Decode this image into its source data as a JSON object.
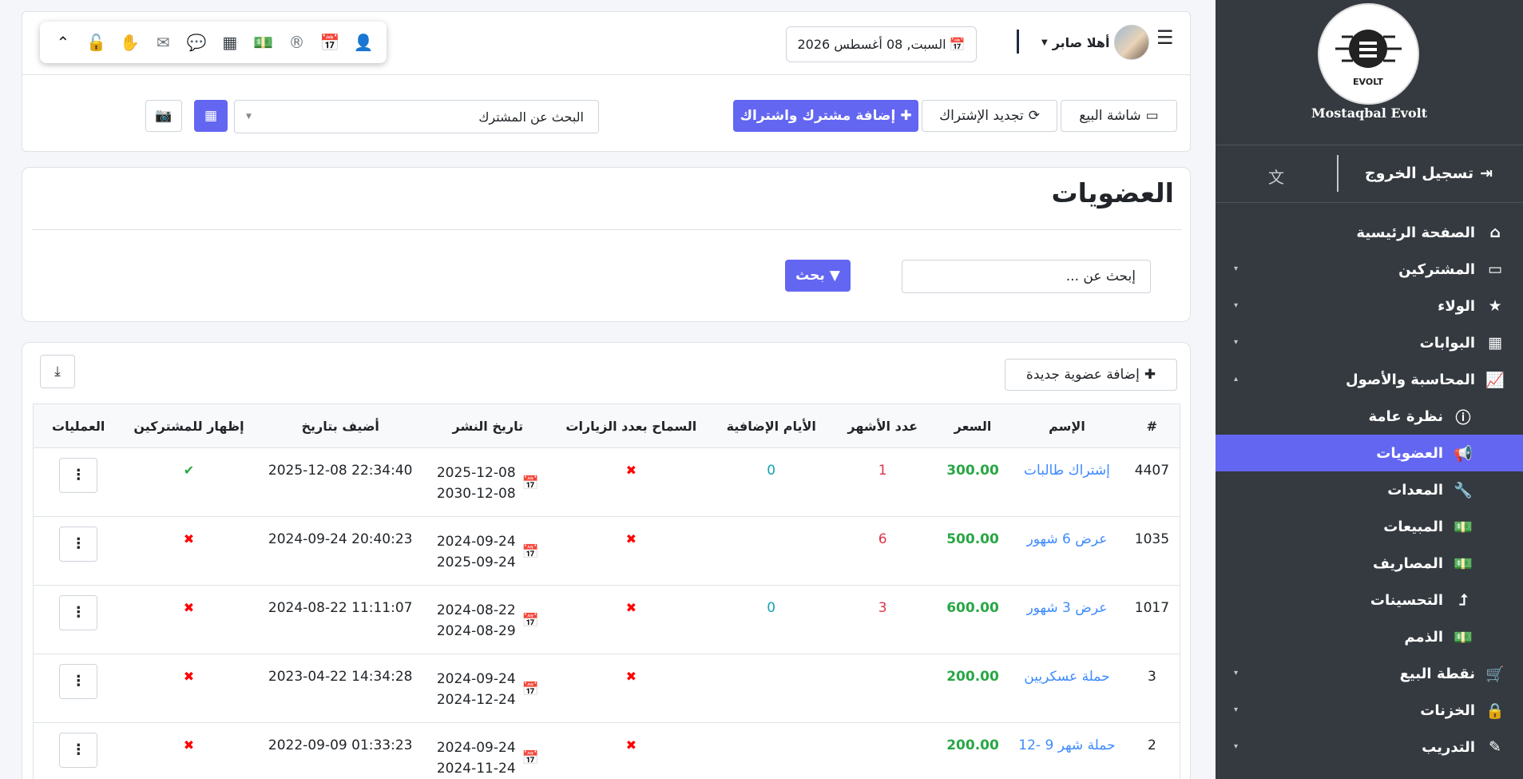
{
  "sidebar": {
    "brand_name": "Mostaqbal Evolt",
    "logout_label": "تسجيل الخروج",
    "items": [
      {
        "label": "الصفحة الرئيسية",
        "icon": "home-icon",
        "glyph": "⌂",
        "caret": "",
        "sub": false,
        "active": false
      },
      {
        "label": "المشتركين",
        "icon": "laptop-icon",
        "glyph": "▭",
        "caret": "▾",
        "sub": false,
        "active": false
      },
      {
        "label": "الولاء",
        "icon": "star-icon",
        "glyph": "★",
        "caret": "▾",
        "sub": false,
        "active": false
      },
      {
        "label": "البوابات",
        "icon": "building-icon",
        "glyph": "▦",
        "caret": "▾",
        "sub": false,
        "active": false
      },
      {
        "label": "المحاسبة والأصول",
        "icon": "chart-line-icon",
        "glyph": "📈",
        "caret": "▴",
        "sub": false,
        "active": false
      },
      {
        "label": "نظرة عامة",
        "icon": "info-icon",
        "glyph": "ⓘ",
        "caret": "",
        "sub": true,
        "active": false
      },
      {
        "label": "العضويات",
        "icon": "megaphone-icon",
        "glyph": "📢",
        "caret": "",
        "sub": true,
        "active": true
      },
      {
        "label": "المعدات",
        "icon": "wrench-icon",
        "glyph": "🔧",
        "caret": "",
        "sub": true,
        "active": false
      },
      {
        "label": "المبيعات",
        "icon": "money-icon",
        "glyph": "💵",
        "caret": "",
        "sub": true,
        "active": false
      },
      {
        "label": "المصاريف",
        "icon": "money-icon",
        "glyph": "💵",
        "caret": "",
        "sub": true,
        "active": false
      },
      {
        "label": "التحسينات",
        "icon": "arrow-up-icon",
        "glyph": "⮥",
        "caret": "",
        "sub": true,
        "active": false
      },
      {
        "label": "الذمم",
        "icon": "money-icon",
        "glyph": "💵",
        "caret": "",
        "sub": true,
        "active": false
      },
      {
        "label": "نقطة البيع",
        "icon": "cart-icon",
        "glyph": "🛒",
        "caret": "▾",
        "sub": false,
        "active": false
      },
      {
        "label": "الخزنات",
        "icon": "lock-icon",
        "glyph": "🔒",
        "caret": "▾",
        "sub": false,
        "active": false
      },
      {
        "label": "التدريب",
        "icon": "magic-wand-icon",
        "glyph": "✎",
        "caret": "▾",
        "sub": false,
        "active": false
      }
    ]
  },
  "topbar": {
    "date": "السبت, 08 أغسطس 2026",
    "greeting": "أهلا صابر",
    "pill_icons": [
      {
        "name": "chevron-up-icon",
        "glyph": "⌃",
        "color": "#212529"
      },
      {
        "name": "unlock-icon",
        "glyph": "🔓",
        "color": "#212529"
      },
      {
        "name": "hand-icon",
        "glyph": "✋",
        "color": "#17a2b8"
      },
      {
        "name": "envelope-icon",
        "glyph": "✉",
        "color": "#6c757d"
      },
      {
        "name": "comment-icon",
        "glyph": "💬",
        "color": "#6c757d"
      },
      {
        "name": "qrcode-icon",
        "glyph": "▦",
        "color": "#343a40"
      },
      {
        "name": "money-bill-icon",
        "glyph": "💵",
        "color": "#e83e8c"
      },
      {
        "name": "registered-icon",
        "glyph": "®",
        "color": "#6c757d"
      },
      {
        "name": "calendar-icon",
        "glyph": "📅",
        "color": "#007bff"
      },
      {
        "name": "user-plus-icon",
        "glyph": "👤",
        "color": "#28a745"
      }
    ],
    "pos_label": "شاشة البيع",
    "renew_label": "تجديد الإشتراك",
    "add_subscriber_label": "إضافة مشترك واشتراك",
    "subscriber_search_placeholder": "البحث عن المشترك"
  },
  "filter": {
    "title": "العضويات",
    "search_placeholder": "إبحث عن ...",
    "search_button": "بحث"
  },
  "table": {
    "add_membership_label": "إضافة عضوية جديدة",
    "headers": {
      "id": "#",
      "name": "الإسم",
      "price": "السعر",
      "months": "عدد الأشهر",
      "extra_days": "الأيام الإضافية",
      "visits": "السماح بعدد الزيارات",
      "publish_date": "تاريخ النشر",
      "added_at": "أضيف بتاريخ",
      "show": "إظهار للمشتركين",
      "ops": "العمليات"
    },
    "rows": [
      {
        "id": "4407",
        "name": "إشتراك طالبات",
        "price": "300.00",
        "months": "1",
        "extra_days": "0",
        "visits": "✖",
        "pub_start": "2025-12-08",
        "pub_end": "2030-12-08",
        "added_at": "2025-12-08 22:34:40",
        "show": "✔",
        "show_ok": true,
        "ops": "⋮"
      },
      {
        "id": "1035",
        "name": "عرض 6 شهور",
        "price": "500.00",
        "months": "6",
        "extra_days": "",
        "visits": "✖",
        "pub_start": "2024-09-24",
        "pub_end": "2025-09-24",
        "added_at": "2024-09-24 20:40:23",
        "show": "✖",
        "show_ok": false,
        "ops": "⋮"
      },
      {
        "id": "1017",
        "name": "عرض 3 شهور",
        "price": "600.00",
        "months": "3",
        "extra_days": "0",
        "visits": "✖",
        "pub_start": "2024-08-22",
        "pub_end": "2024-08-29",
        "added_at": "2024-08-22 11:11:07",
        "show": "✖",
        "show_ok": false,
        "ops": "⋮"
      },
      {
        "id": "3",
        "name": "حملة عسكريين",
        "price": "200.00",
        "months": "",
        "extra_days": "",
        "visits": "✖",
        "pub_start": "2024-09-24",
        "pub_end": "2024-12-24",
        "added_at": "2023-04-22 14:34:28",
        "show": "✖",
        "show_ok": false,
        "ops": "⋮"
      },
      {
        "id": "2",
        "name": "حملة شهر 9 -12",
        "price": "200.00",
        "months": "",
        "extra_days": "",
        "visits": "✖",
        "pub_start": "2024-09-24",
        "pub_end": "2024-11-24",
        "added_at": "2022-09-09 01:33:23",
        "show": "✖",
        "show_ok": false,
        "ops": "⋮"
      }
    ]
  }
}
